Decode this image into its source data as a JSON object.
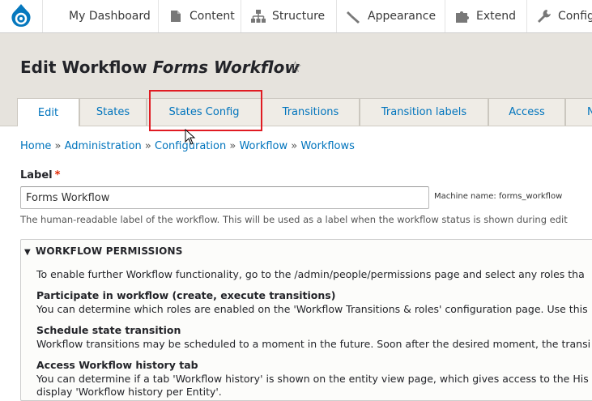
{
  "toolbar": {
    "items": [
      {
        "label": "My Dashboard",
        "icon": "dashboard"
      },
      {
        "label": "Content",
        "icon": "page-icon"
      },
      {
        "label": "Structure",
        "icon": "sitemap-icon"
      },
      {
        "label": "Appearance",
        "icon": "paintbrush-icon"
      },
      {
        "label": "Extend",
        "icon": "puzzle-icon"
      },
      {
        "label": "Configu",
        "icon": "wrench-icon"
      }
    ],
    "logo_icon": "drupal-drop-icon"
  },
  "header": {
    "title_prefix": "Edit Workflow",
    "title_name": "Forms Workflow",
    "star_icon": "star-outline-icon"
  },
  "tabs": [
    {
      "label": "Edit",
      "active": true
    },
    {
      "label": "States"
    },
    {
      "label": "States Config"
    },
    {
      "label": "Transitions"
    },
    {
      "label": "Transition labels"
    },
    {
      "label": "Access"
    },
    {
      "label": "N"
    }
  ],
  "breadcrumb": [
    "Home",
    "Administration",
    "Configuration",
    "Workflow",
    "Workflows"
  ],
  "breadcrumb_separator": "»",
  "form": {
    "label": "Label",
    "required_mark": "*",
    "value": "Forms Workflow",
    "machine_name": "Machine name: forms_workflow",
    "description": "The human-readable label of the workflow. This will be used as a label when the workflow status is shown during edit"
  },
  "permissions": {
    "summary": "WORKFLOW PERMISSIONS",
    "intro": "To enable further Workflow functionality, go to the /admin/people/permissions page and select any roles tha",
    "items": [
      {
        "title": "Participate in workflow (create, execute transitions)",
        "text": "You can determine which roles are enabled on the 'Workflow Transitions & roles' configuration page. Use this"
      },
      {
        "title": "Schedule state transition",
        "text": "Workflow transitions may be scheduled to a moment in the future. Soon after the desired moment, the transi"
      },
      {
        "title": "Access Workflow history tab",
        "text": "You can determine if a tab 'Workflow history' is shown on the entity view page, which gives access to the His"
      }
    ],
    "trailing": "display 'Workflow history per Entity'."
  },
  "colors": {
    "accent": "#0074bd",
    "highlight": "#e01b22",
    "header_bg": "#e6e3dd"
  }
}
